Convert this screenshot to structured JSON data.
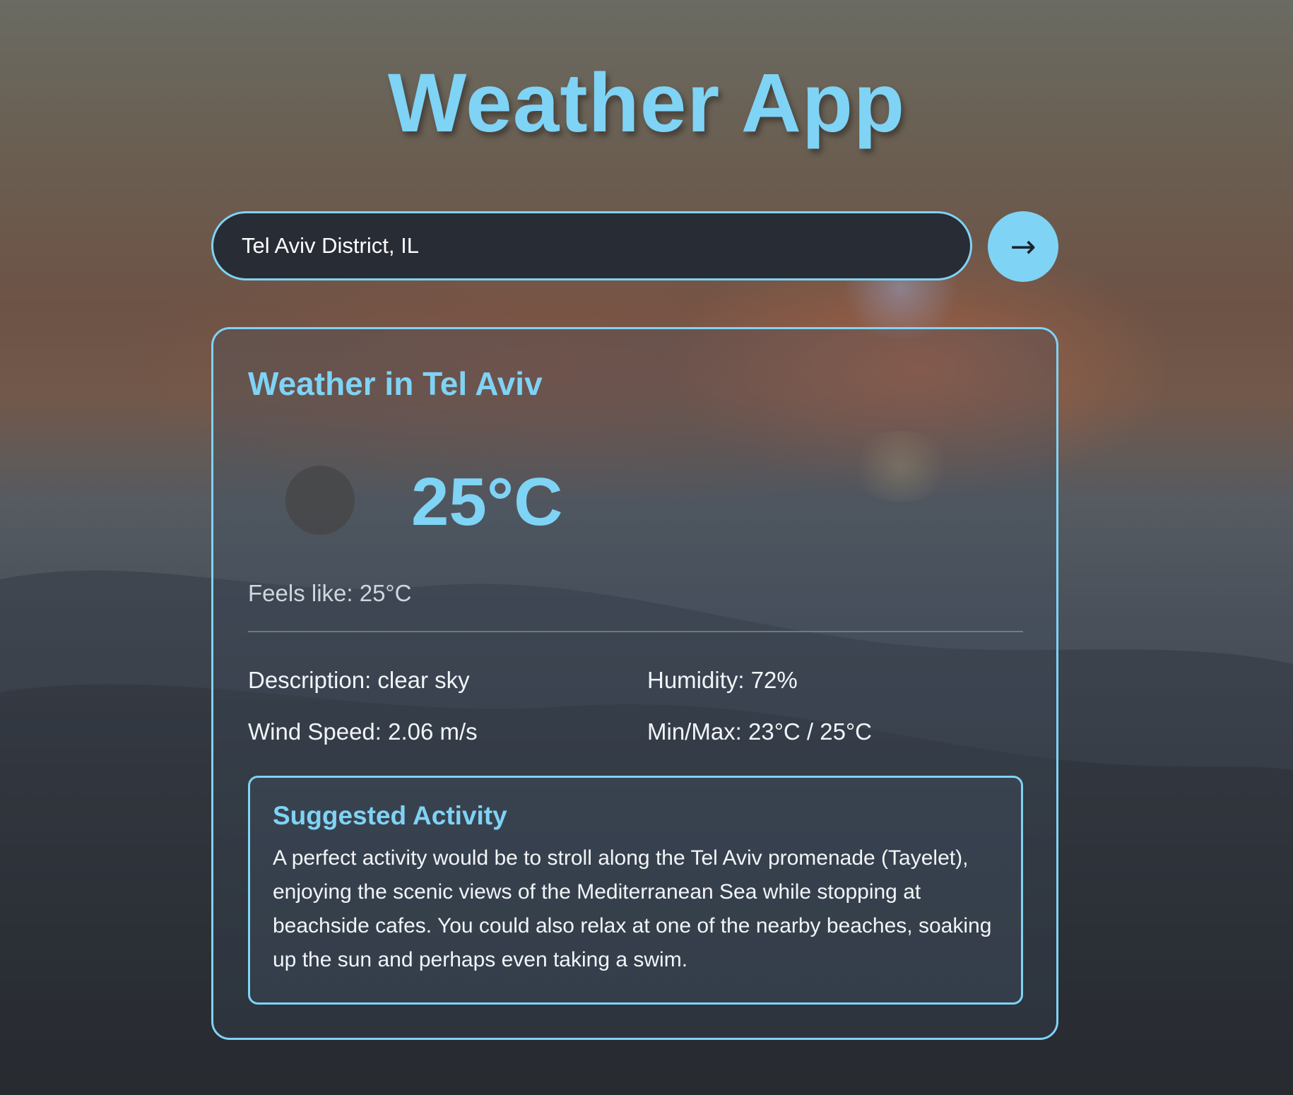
{
  "app": {
    "title": "Weather App"
  },
  "search": {
    "value": "Tel Aviv District, IL",
    "button_icon": "→",
    "icon_name": "arrow-right-icon"
  },
  "weather": {
    "heading": "Weather in Tel Aviv",
    "icon_name": "weather-icon",
    "temperature": "25°C",
    "feels_like": "Feels like: 25°C",
    "description": "Description: clear sky",
    "humidity": "Humidity: 72%",
    "wind_speed": "Wind Speed: 2.06 m/s",
    "min_max": "Min/Max: 23°C / 25°C"
  },
  "activity": {
    "heading": "Suggested Activity",
    "text": "A perfect activity would be to stroll along the Tel Aviv promenade (Tayelet), enjoying the scenic views of the Mediterranean Sea while stopping at beachside cafes. You could also relax at one of the nearby beaches, soaking up the sun and perhaps even taking a swim."
  },
  "colors": {
    "accent": "#7fd3f5",
    "input_background": "#282c35"
  }
}
